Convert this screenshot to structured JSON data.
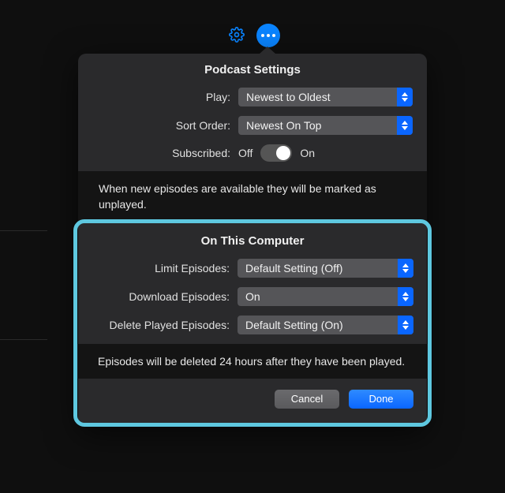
{
  "header": {
    "title": "Podcast Settings"
  },
  "settings": {
    "play": {
      "label": "Play:",
      "value": "Newest to Oldest"
    },
    "sort": {
      "label": "Sort Order:",
      "value": "Newest On Top"
    },
    "subscribed": {
      "label": "Subscribed:",
      "off": "Off",
      "on": "On",
      "state": true
    }
  },
  "info1": "When new episodes are available they will be marked as unplayed.",
  "computer": {
    "title": "On This Computer",
    "limit": {
      "label": "Limit Episodes:",
      "value": "Default Setting (Off)"
    },
    "download": {
      "label": "Download Episodes:",
      "value": "On"
    },
    "delete": {
      "label": "Delete Played Episodes:",
      "value": "Default Setting (On)"
    }
  },
  "info2": "Episodes will be deleted 24 hours after they have been played.",
  "buttons": {
    "cancel": "Cancel",
    "done": "Done"
  }
}
